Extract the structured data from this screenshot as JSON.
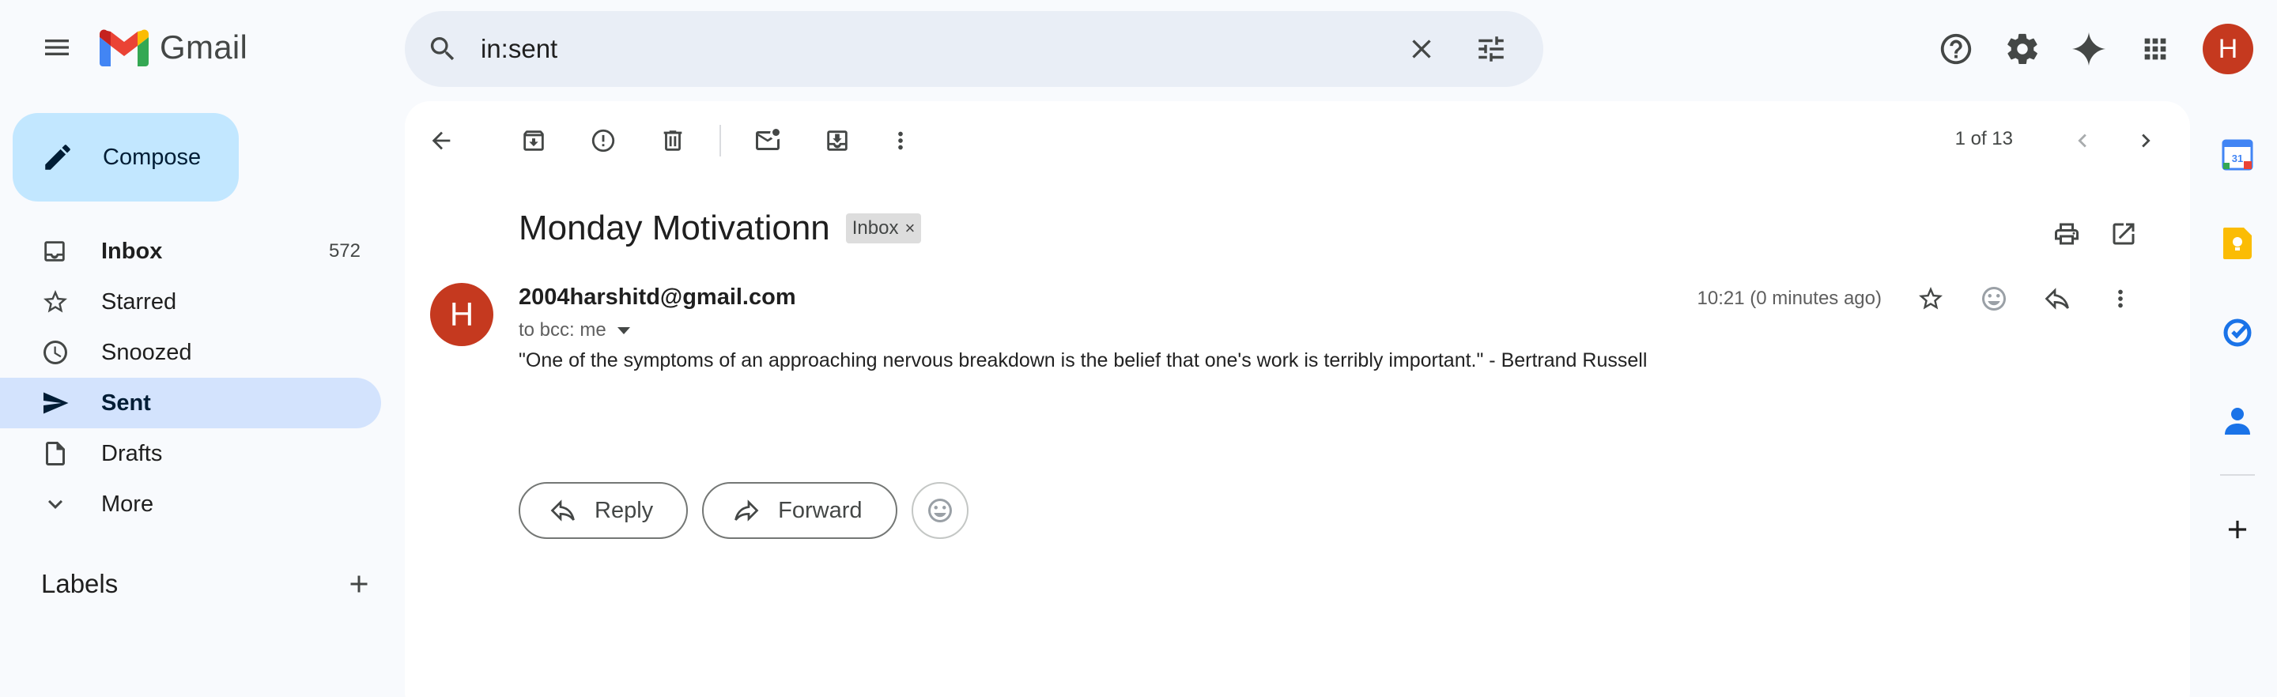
{
  "app": {
    "name": "Gmail"
  },
  "search": {
    "value": "in:sent"
  },
  "compose": {
    "label": "Compose"
  },
  "nav": {
    "items": [
      {
        "label": "Inbox",
        "count": "572"
      },
      {
        "label": "Starred",
        "count": ""
      },
      {
        "label": "Snoozed",
        "count": ""
      },
      {
        "label": "Sent",
        "count": ""
      },
      {
        "label": "Drafts",
        "count": ""
      },
      {
        "label": "More",
        "count": ""
      }
    ],
    "labels_title": "Labels"
  },
  "toolbar": {
    "pager": "1 of 13"
  },
  "email": {
    "subject": "Monday Motivationn",
    "label_chip": "Inbox",
    "chip_close": "×",
    "avatar_letter": "H",
    "sender": "2004harshitd@gmail.com",
    "recipients": "to bcc: me",
    "timestamp": "10:21 (0 minutes ago)",
    "body": "\"One of the symptoms of an approaching nervous breakdown is the belief that one's work is terribly important.\" - Bertrand Russell"
  },
  "actions": {
    "reply": "Reply",
    "forward": "Forward"
  },
  "account": {
    "avatar_letter": "H"
  },
  "side_panel": {
    "calendar_day": "31"
  },
  "colors": {
    "accent": "#c2e7ff",
    "active_nav": "#d3e3fd",
    "avatar": "#c5391f",
    "background": "#f8fafd"
  }
}
